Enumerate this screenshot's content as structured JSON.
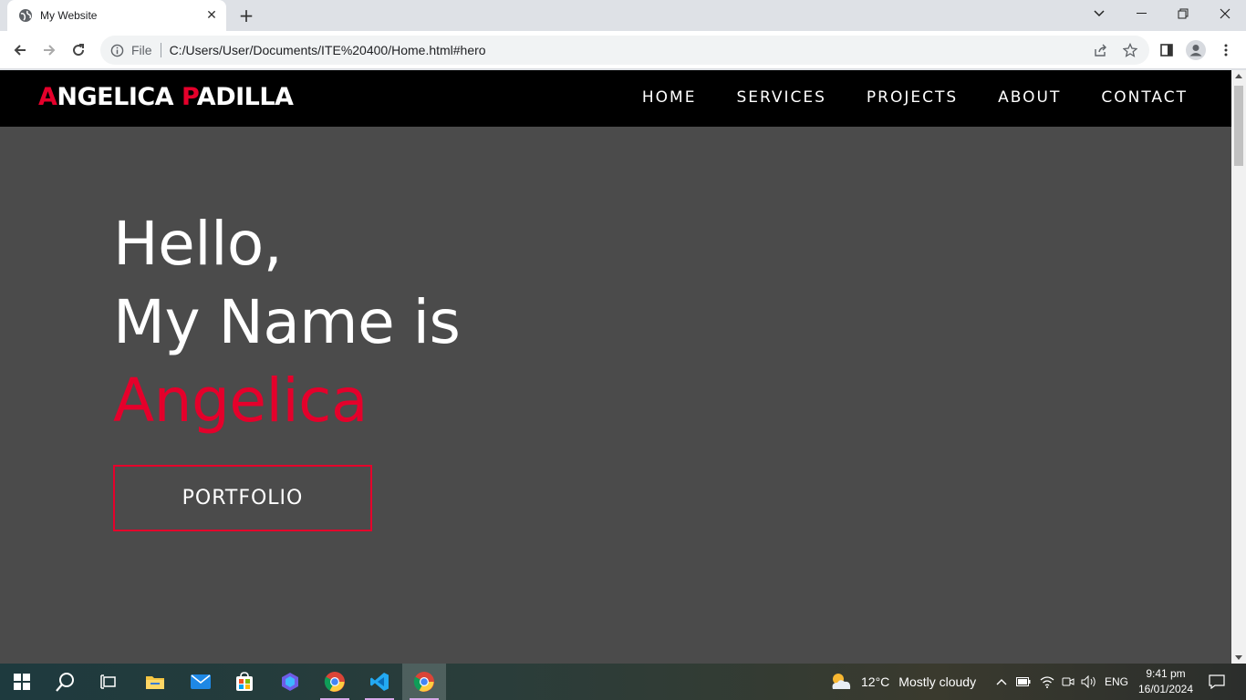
{
  "browser": {
    "tab_title": "My Website",
    "address": {
      "scheme_label": "File",
      "url": "C:/Users/User/Documents/ITE%20400/Home.html#hero"
    }
  },
  "site": {
    "logo": {
      "first_initial": "A",
      "first_rest": "NGELICA ",
      "last_initial": "P",
      "last_rest": "ADILLA"
    },
    "nav": [
      "HOME",
      "SERVICES",
      "PROJECTS",
      "ABOUT",
      "CONTACT"
    ],
    "hero": {
      "line1": "Hello,",
      "line2": "My Name is",
      "name": "Angelica",
      "button": "PORTFOLIO"
    },
    "colors": {
      "accent": "#e5002b",
      "nav_bg": "#000000",
      "hero_bg": "#4b4b4b"
    }
  },
  "taskbar": {
    "weather": {
      "temp": "12°C",
      "condition": "Mostly cloudy"
    },
    "language": "ENG",
    "time": "9:41 pm",
    "date": "16/01/2024"
  }
}
